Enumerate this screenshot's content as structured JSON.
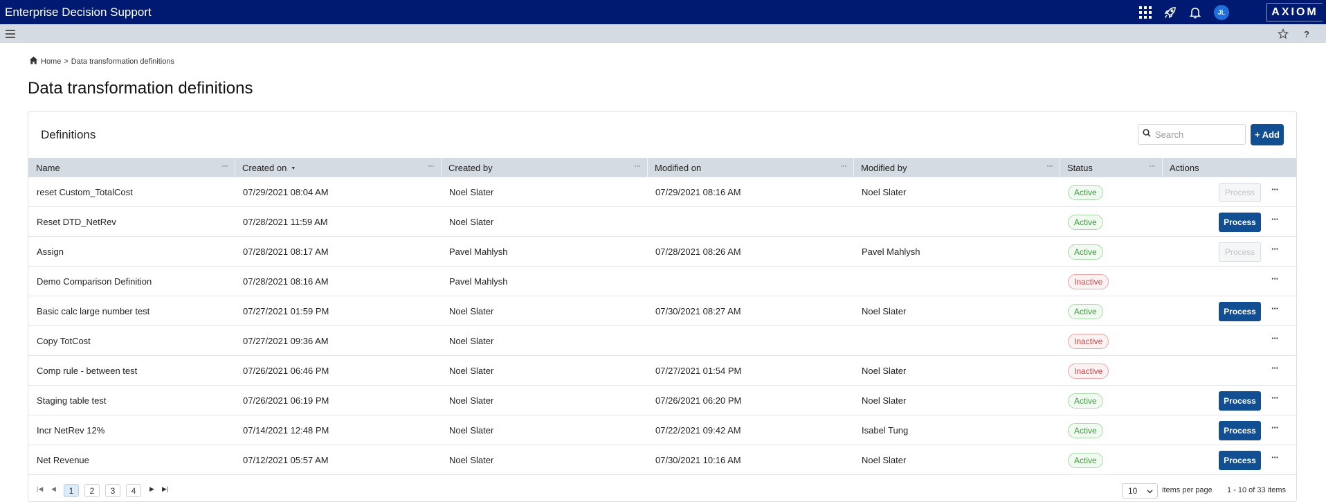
{
  "app": {
    "title": "Enterprise Decision Support",
    "logo": "AXIOM",
    "user_initials": "JL"
  },
  "breadcrumb": {
    "home": "Home",
    "separator": ">",
    "current": "Data transformation definitions"
  },
  "page": {
    "title": "Data transformation definitions"
  },
  "panel": {
    "title": "Definitions",
    "search_placeholder": "Search",
    "add_label": "+ Add"
  },
  "columns": {
    "name": "Name",
    "created_on": "Created on",
    "created_by": "Created by",
    "modified_on": "Modified on",
    "modified_by": "Modified by",
    "status": "Status",
    "actions": "Actions"
  },
  "column_menu_glyph": "···",
  "process_label": "Process",
  "rows": [
    {
      "name": "reset Custom_TotalCost",
      "created_on": "07/29/2021 08:04 AM",
      "created_by": "Noel Slater",
      "modified_on": "07/29/2021 08:16 AM",
      "modified_by": "Noel Slater",
      "status": "Active",
      "process": "disabled"
    },
    {
      "name": "Reset DTD_NetRev",
      "created_on": "07/28/2021 11:59 AM",
      "created_by": "Noel Slater",
      "modified_on": "",
      "modified_by": "",
      "status": "Active",
      "process": "enabled"
    },
    {
      "name": "Assign",
      "created_on": "07/28/2021 08:17 AM",
      "created_by": "Pavel Mahlysh",
      "modified_on": "07/28/2021 08:26 AM",
      "modified_by": "Pavel Mahlysh",
      "status": "Active",
      "process": "disabled"
    },
    {
      "name": "Demo Comparison Definition",
      "created_on": "07/28/2021 08:16 AM",
      "created_by": "Pavel Mahlysh",
      "modified_on": "",
      "modified_by": "",
      "status": "Inactive",
      "process": "none"
    },
    {
      "name": "Basic calc large number test",
      "created_on": "07/27/2021 01:59 PM",
      "created_by": "Noel Slater",
      "modified_on": "07/30/2021 08:27 AM",
      "modified_by": "Noel Slater",
      "status": "Active",
      "process": "enabled"
    },
    {
      "name": "Copy TotCost",
      "created_on": "07/27/2021 09:36 AM",
      "created_by": "Noel Slater",
      "modified_on": "",
      "modified_by": "",
      "status": "Inactive",
      "process": "none"
    },
    {
      "name": "Comp rule - between test",
      "created_on": "07/26/2021 06:46 PM",
      "created_by": "Noel Slater",
      "modified_on": "07/27/2021 01:54 PM",
      "modified_by": "Noel Slater",
      "status": "Inactive",
      "process": "none"
    },
    {
      "name": "Staging table test",
      "created_on": "07/26/2021 06:19 PM",
      "created_by": "Noel Slater",
      "modified_on": "07/26/2021 06:20 PM",
      "modified_by": "Noel Slater",
      "status": "Active",
      "process": "enabled"
    },
    {
      "name": "Incr NetRev 12%",
      "created_on": "07/14/2021 12:48 PM",
      "created_by": "Noel Slater",
      "modified_on": "07/22/2021 09:42 AM",
      "modified_by": "Isabel Tung",
      "status": "Active",
      "process": "enabled"
    },
    {
      "name": "Net Revenue",
      "created_on": "07/12/2021 05:57 AM",
      "created_by": "Noel Slater",
      "modified_on": "07/30/2021 10:16 AM",
      "modified_by": "Noel Slater",
      "status": "Active",
      "process": "enabled"
    }
  ],
  "pager": {
    "pages": [
      "1",
      "2",
      "3",
      "4"
    ],
    "current_page": "1",
    "page_size": "10",
    "items_per_page_label": "items per page",
    "summary": "1 - 10 of 33 items"
  },
  "colors": {
    "topbar": "#001a72",
    "subbar": "#d5dbe2",
    "primary": "#124e92",
    "active": "#3a9a3a",
    "inactive": "#d64545"
  }
}
